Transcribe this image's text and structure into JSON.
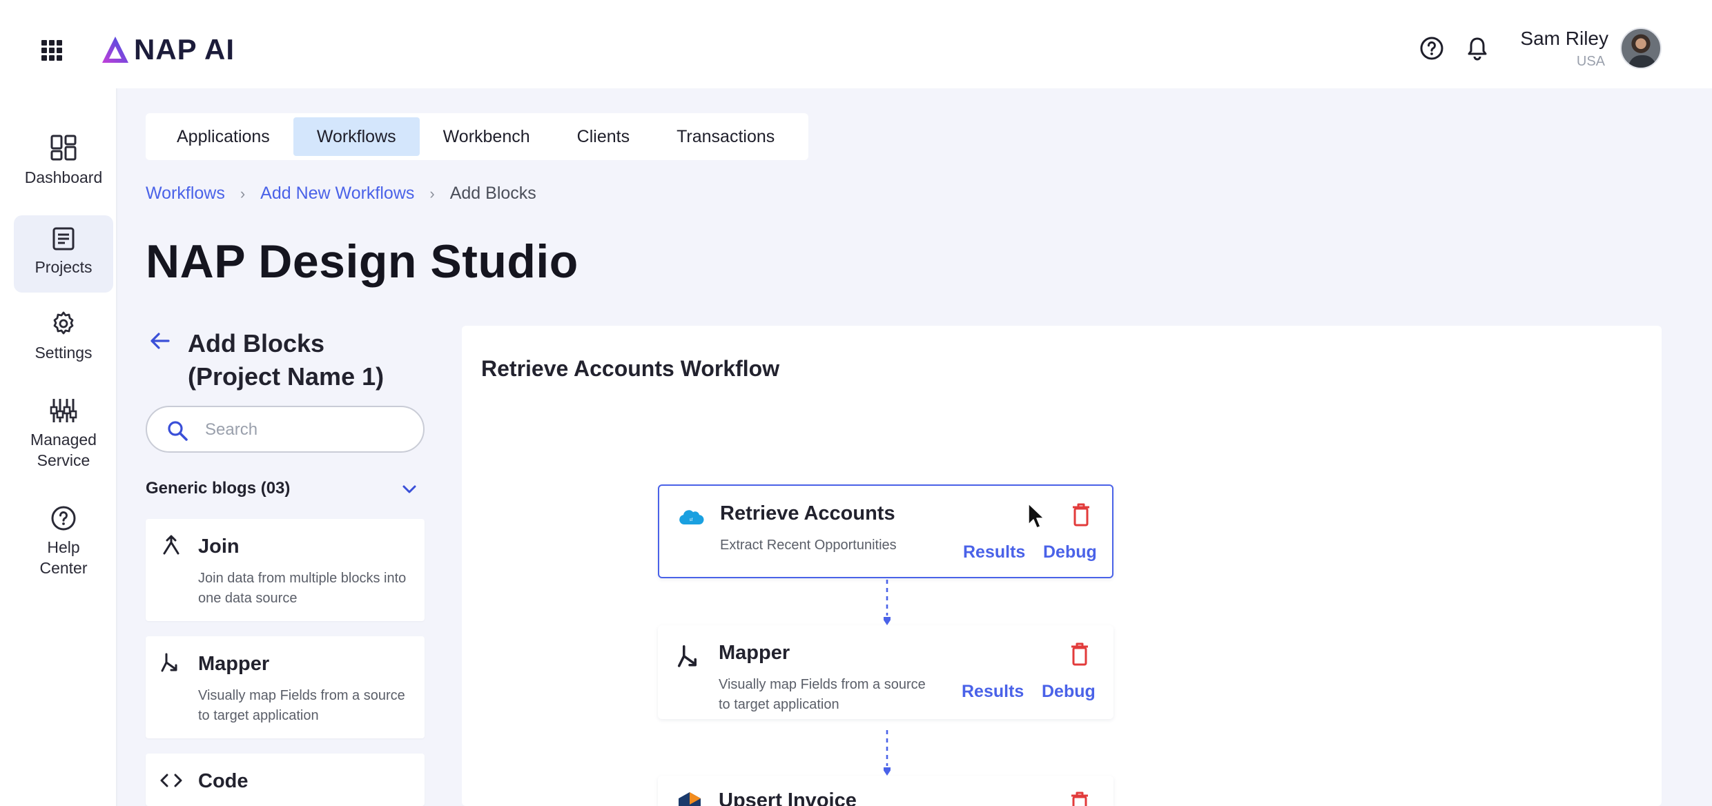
{
  "app": {
    "logo_text": "NAP AI",
    "accent_color": "#4a62e8",
    "danger_color": "#e23b3b"
  },
  "header": {
    "user_name": "Sam Riley",
    "user_country": "USA",
    "icons": [
      "apps-grid-icon",
      "help-icon",
      "notification-bell-icon"
    ]
  },
  "sidebar": {
    "items": [
      {
        "label": "Dashboard",
        "icon": "dashboard-icon",
        "active": false
      },
      {
        "label": "Projects",
        "icon": "projects-icon",
        "active": true
      },
      {
        "label": "Settings",
        "icon": "settings-gear-icon",
        "active": false
      },
      {
        "label": "Managed Service",
        "label_line1": "Managed",
        "label_line2": "Service",
        "icon": "sliders-icon",
        "active": false
      },
      {
        "label": "Help Center",
        "label_line1": "Help",
        "label_line2": "Center",
        "icon": "help-center-icon",
        "active": false
      }
    ]
  },
  "tabs": [
    {
      "label": "Applications",
      "active": false
    },
    {
      "label": "Workflows",
      "active": true
    },
    {
      "label": "Workbench",
      "active": false
    },
    {
      "label": "Clients",
      "active": false
    },
    {
      "label": "Transactions",
      "active": false
    }
  ],
  "breadcrumb": {
    "items": [
      "Workflows",
      "Add New Workflows",
      "Add Blocks"
    ],
    "separator": "›"
  },
  "page": {
    "title": "NAP Design Studio"
  },
  "blocks_panel": {
    "title_line1": "Add Blocks",
    "title_line2": "(Project Name 1)",
    "search_placeholder": "Search",
    "group_label": "Generic blogs (03)",
    "blocks": [
      {
        "name": "Join",
        "description": "Join data from multiple blocks into one data source",
        "icon": "join-merge-icon"
      },
      {
        "name": "Mapper",
        "description": "Visually map Fields from a source to target application",
        "icon": "mapper-split-icon"
      },
      {
        "name": "Code",
        "description": "",
        "icon": "code-brackets-icon"
      }
    ]
  },
  "workflow": {
    "title": "Retrieve Accounts Workflow",
    "nodes": [
      {
        "title": "Retrieve Accounts",
        "description": "Extract Recent Opportunities",
        "icon": "salesforce-cloud-icon",
        "results_label": "Results",
        "debug_label": "Debug",
        "selected": true
      },
      {
        "title": "Mapper",
        "description": "Visually map Fields from a source to target application",
        "icon": "mapper-split-icon",
        "results_label": "Results",
        "debug_label": "Debug",
        "selected": false
      },
      {
        "title": "Upsert Invoice",
        "description": "",
        "icon": "invoice-hexagon-icon",
        "results_label": "",
        "debug_label": "",
        "selected": false
      }
    ]
  }
}
